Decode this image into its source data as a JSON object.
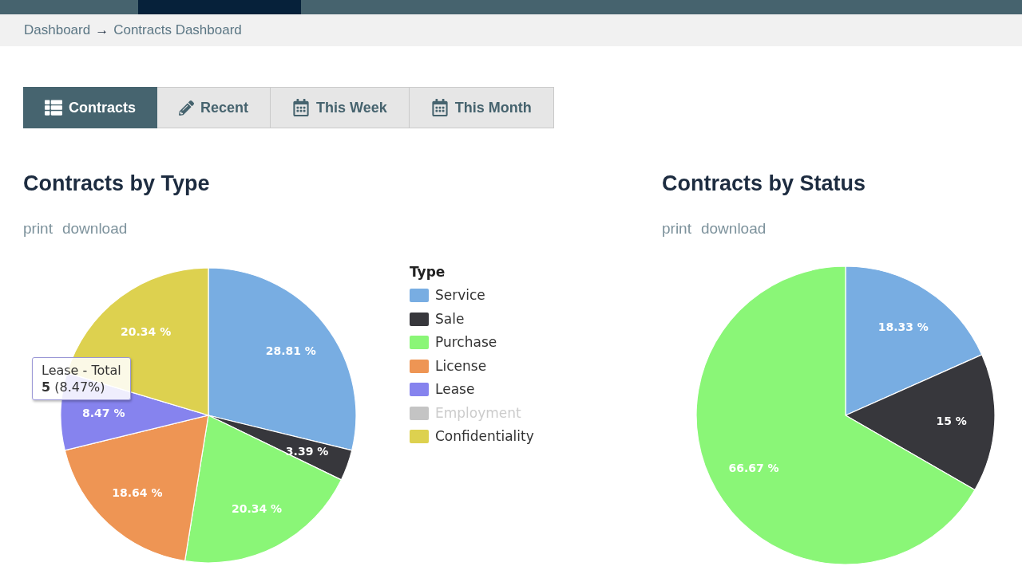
{
  "breadcrumb": {
    "items": [
      "Dashboard",
      "Contracts Dashboard"
    ],
    "separator": "→"
  },
  "tabs": [
    {
      "label": "Contracts",
      "selected": true
    },
    {
      "label": "Recent",
      "selected": false
    },
    {
      "label": "This Week",
      "selected": false
    },
    {
      "label": "This Month",
      "selected": false
    }
  ],
  "panels": [
    {
      "title": "Contracts by Type",
      "links": [
        "print",
        "download"
      ],
      "chart_data": [
        {
          "type": "pie",
          "categories": [
            "Service",
            "Sale",
            "Purchase",
            "License",
            "Lease",
            "Employment",
            "Confidentiality"
          ],
          "values": [
            28.81,
            3.39,
            20.34,
            18.64,
            8.47,
            null,
            20.34
          ],
          "value_labels": [
            "28.81 %",
            "3.39 %",
            "20.34 %",
            "18.64 %",
            "8.47 %",
            null,
            "20.34 %"
          ],
          "colors": [
            "#78ade2",
            "#37373c",
            "#8af677",
            "#ee9554",
            "#8683ee",
            "#c4c4c4",
            "#ddd14f"
          ],
          "data_labels": true,
          "legend": "right",
          "legend_title": "Type"
        }
      ],
      "tooltip": {
        "title": "Lease - Total",
        "text": "**5** (8.47%)"
      }
    },
    {
      "title": "Contracts by Status",
      "links": [
        "print",
        "download"
      ],
      "chart_data": [
        {
          "type": "pie",
          "categories": [
            null,
            null,
            null
          ],
          "values": [
            18.33,
            15,
            66.67
          ],
          "value_labels": [
            "18.33 %",
            "15 %",
            "66.67 %"
          ],
          "colors": [
            "#78ade2",
            "#37373c",
            "#8af677"
          ],
          "data_labels": true
        }
      ]
    }
  ]
}
